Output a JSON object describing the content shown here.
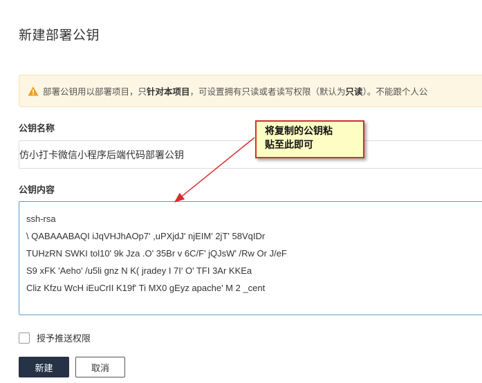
{
  "page": {
    "title": "新建部署公钥"
  },
  "notice": {
    "text_pre": "部署公钥用以部署项目，只",
    "text_bold1": "针对本项目",
    "text_mid": "，可设置拥有只读或者读写权限（默认为",
    "text_bold2": "只读",
    "text_post": "）。不能跟个人公"
  },
  "form": {
    "name_label": "公钥名称",
    "name_value": "仿小打卡微信小程序后端代码部署公钥",
    "content_label": "公钥内容",
    "content_lines": [
      "ssh-rsa",
      "                              \\     QABAAABAQI   iJqVHJhAOp7'  ,uPXjdJ'   njEIM'   2jT'   58VqIDr",
      "TUHzRN    SWKI        tol10'   9k     Jza       .O'      35Br     v     6C/F'   jQJsW'     /Rw    Or      J/eF",
      "S9     xFK          'Aeho'   /u5li      gnz    N     K(      jradey     I          7I'   O'     TFI      3Ar     KKEa",
      "Cliz     Kfzu      WcH      iEuCrII     K19f'    Ti      MX0    gEyz apache'     M        2     _cent"
    ],
    "push_permission_label": "授予推送权限"
  },
  "buttons": {
    "create": "新建",
    "cancel": "取消"
  },
  "annotation": {
    "line1": "将复制的公钥粘",
    "line2": "贴至此即可"
  },
  "colors": {
    "accent": "#263346",
    "warning": "#f0a020",
    "annotation_border": "#d32f2f",
    "annotation_bg": "#fdfdc4"
  }
}
